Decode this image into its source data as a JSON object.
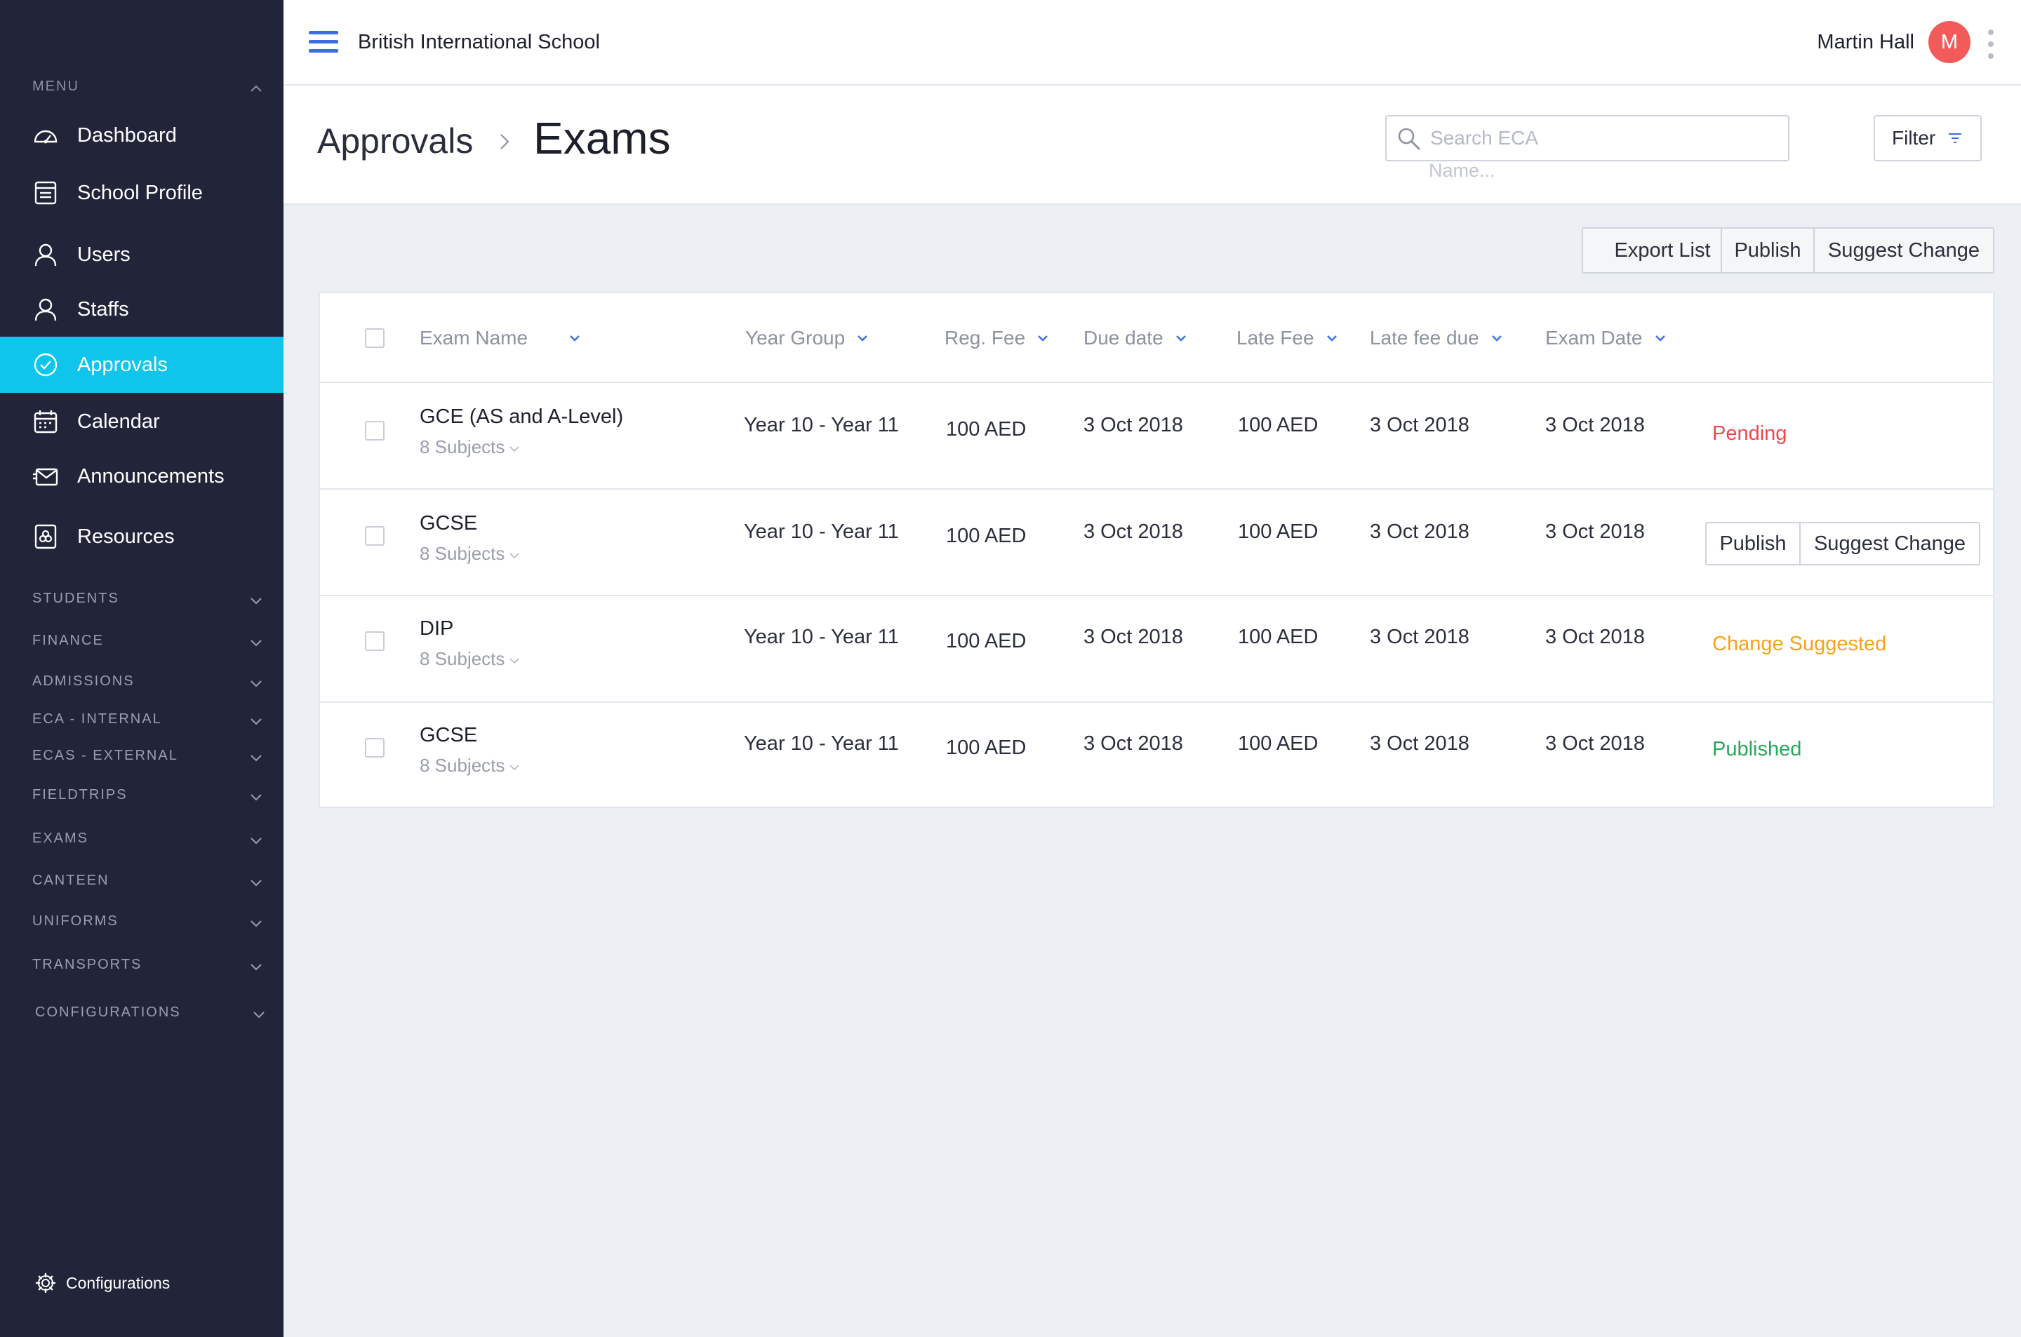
{
  "app": {
    "school_name": "British International School",
    "user_name": "Martin Hall",
    "user_initial": "M"
  },
  "sidebar": {
    "menu_header": "MENU",
    "items": [
      {
        "label": "Dashboard",
        "icon": "dashboard-icon"
      },
      {
        "label": "School Profile",
        "icon": "school-profile-icon"
      },
      {
        "label": "Users",
        "icon": "user-icon"
      },
      {
        "label": "Staffs",
        "icon": "user-icon"
      },
      {
        "label": "Approvals",
        "icon": "check-circle-icon",
        "active": true
      },
      {
        "label": "Calendar",
        "icon": "calendar-icon"
      },
      {
        "label": "Announcements",
        "icon": "envelope-icon"
      },
      {
        "label": "Resources",
        "icon": "resources-icon"
      }
    ],
    "sections": [
      "STUDENTS",
      "FINANCE",
      "ADMISSIONS",
      "ECA - INTERNAL",
      "ECAS - EXTERNAL",
      "FIELDTRIPS",
      "EXAMS",
      "CANTEEN",
      "UNIFORMS",
      "TRANSPORTS",
      "CONFIGURATIONS"
    ],
    "footer_label": "Configurations"
  },
  "page": {
    "breadcrumb_parent": "Approvals",
    "breadcrumb_current": "Exams",
    "search_placeholder": "Search ECA",
    "search_hint": "Name...",
    "filter_label": "Filter"
  },
  "toolbar": {
    "export_label": "Export List",
    "publish_label": "Publish",
    "suggest_label": "Suggest Change"
  },
  "table": {
    "columns": [
      "Exam Name",
      "Year Group",
      "Reg. Fee",
      "Due date",
      "Late Fee",
      "Late fee due",
      "Exam Date"
    ],
    "rows": [
      {
        "name": "GCE (AS and A-Level)",
        "subjects": "8 Subjects",
        "year_group": "Year 10 - Year 11",
        "reg_fee": "100 AED",
        "due_date": "3 Oct 2018",
        "late_fee": "100 AED",
        "late_fee_due": "3 Oct 2018",
        "exam_date": "3 Oct 2018",
        "status": "Pending",
        "status_color": "#f0474b"
      },
      {
        "name": "GCSE",
        "subjects": "8 Subjects",
        "year_group": "Year 10 - Year 11",
        "reg_fee": "100 AED",
        "due_date": "3 Oct 2018",
        "late_fee": "100 AED",
        "late_fee_due": "3 Oct 2018",
        "exam_date": "3 Oct 2018",
        "publish_label": "Publish",
        "suggest_label": "Suggest Change"
      },
      {
        "name": "DIP",
        "subjects": "8 Subjects",
        "year_group": "Year 10 - Year 11",
        "reg_fee": "100 AED",
        "due_date": "3 Oct 2018",
        "late_fee": "100 AED",
        "late_fee_due": "3 Oct 2018",
        "exam_date": "3 Oct 2018",
        "status": "Change Suggested",
        "status_color": "#f5a21b"
      },
      {
        "name": "GCSE",
        "subjects": "8 Subjects",
        "year_group": "Year 10 - Year 11",
        "reg_fee": "100 AED",
        "due_date": "3 Oct 2018",
        "late_fee": "100 AED",
        "late_fee_due": "3 Oct 2018",
        "exam_date": "3 Oct 2018",
        "status": "Published",
        "status_color": "#27a85a"
      }
    ]
  },
  "colors": {
    "sidebar_bg": "#22253a",
    "active_item": "#0fc5ec",
    "accent_blue": "#3b6fe0",
    "avatar": "#f35b5b"
  }
}
